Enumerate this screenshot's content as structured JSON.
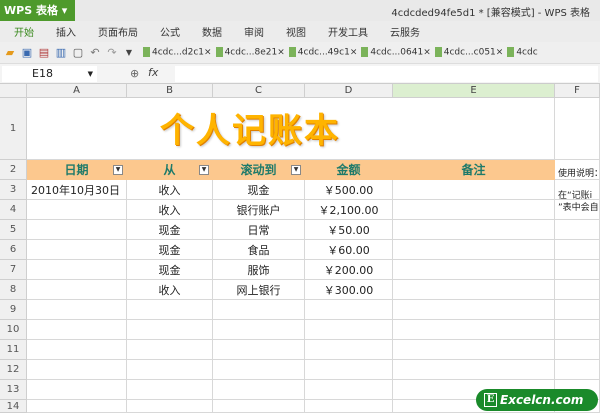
{
  "app": {
    "name": "WPS 表格",
    "window_title": "4cdcded94fe5d1 * [兼容模式] - WPS 表格"
  },
  "menu": [
    "开始",
    "插入",
    "页面布局",
    "公式",
    "数据",
    "审阅",
    "视图",
    "开发工具",
    "云服务"
  ],
  "doc_tabs": [
    "4cdc...d2c1",
    "4cdc...8e21",
    "4cdc...49c1",
    "4cdc...0641",
    "4cdc...c051",
    "4cdc"
  ],
  "formula_bar": {
    "name_box": "E18",
    "fx": "fx",
    "value": ""
  },
  "columns": [
    "A",
    "B",
    "C",
    "D",
    "E",
    "F"
  ],
  "rows": [
    "1",
    "2",
    "3",
    "4",
    "5",
    "6",
    "7",
    "8",
    "9",
    "10",
    "11",
    "12",
    "13",
    "14"
  ],
  "sheet_title": "个人记账本",
  "headers": [
    "日期",
    "从",
    "滚动到",
    "金额",
    "备注"
  ],
  "data_rows": [
    [
      "2010年10月30日",
      "收入",
      "现金",
      "￥500.00",
      ""
    ],
    [
      "",
      "收入",
      "银行账户",
      "￥2,100.00",
      ""
    ],
    [
      "",
      "现金",
      "日常",
      "￥50.00",
      ""
    ],
    [
      "",
      "现金",
      "食品",
      "￥60.00",
      ""
    ],
    [
      "",
      "现金",
      "服饰",
      "￥200.00",
      ""
    ],
    [
      "",
      "收入",
      "网上银行",
      "￥300.00",
      ""
    ]
  ],
  "notes": {
    "title": "使用说明：",
    "line1": "在“记账i",
    "line2": "”表中会自"
  },
  "watermark": "Excelcn.com"
}
